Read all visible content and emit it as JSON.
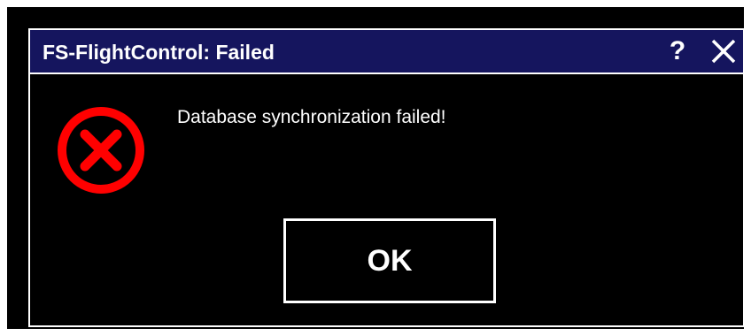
{
  "dialog": {
    "title": "FS-FlightControl: Failed",
    "help_label": "?",
    "close_icon": "close-icon",
    "message": "Database synchronization failed!",
    "icon": "error-icon",
    "ok_label": "OK"
  },
  "colors": {
    "title_bar": "#15155e",
    "background": "#000000",
    "text": "#ffffff",
    "error": "#ff0000"
  }
}
